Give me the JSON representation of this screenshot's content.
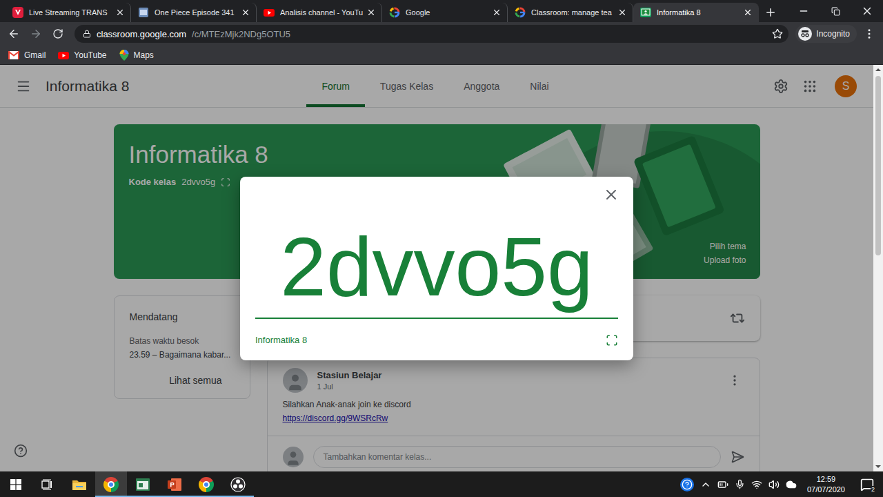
{
  "browser": {
    "tabs": [
      {
        "label": "Live Streaming TRANS",
        "kind": "vidio",
        "selected": false
      },
      {
        "label": "One Piece Episode 341",
        "kind": "page",
        "selected": false
      },
      {
        "label": "Analisis channel - YouTu",
        "kind": "youtube",
        "selected": false
      },
      {
        "label": "Google",
        "kind": "google",
        "selected": false
      },
      {
        "label": "Classroom: manage tea",
        "kind": "google",
        "selected": false
      },
      {
        "label": "Informatika 8",
        "kind": "classroom",
        "selected": true
      }
    ],
    "address": {
      "host": "classroom.google.com",
      "path": "/c/MTEzMjk2NDg5OTU5"
    },
    "bookmarked": false,
    "profile": "Incognito",
    "bookmarks": [
      {
        "label": "Gmail",
        "kind": "gmail"
      },
      {
        "label": "YouTube",
        "kind": "youtube"
      },
      {
        "label": "Maps",
        "kind": "maps"
      }
    ]
  },
  "classroom": {
    "title": "Informatika 8",
    "nav": [
      {
        "label": "Forum",
        "selected": true
      },
      {
        "label": "Tugas Kelas",
        "selected": false
      },
      {
        "label": "Anggota",
        "selected": false
      },
      {
        "label": "Nilai",
        "selected": false
      }
    ],
    "avatar": "S",
    "banner": {
      "title": "Informatika 8",
      "code_label": "Kode kelas",
      "code": "2dvvo5g",
      "actions": [
        "Pilih tema",
        "Upload foto"
      ]
    },
    "upcoming": {
      "title": "Mendatang",
      "due": "Batas waktu besok",
      "item": "23.59 – Bagaimana kabar...",
      "link": "Lihat semua"
    },
    "posts": [
      {
        "author": "Stasiun Belajar",
        "date": "1 Jul",
        "text": "Silahkan Anak-anak join ke discord",
        "link": "https://discord.gg/9WSRcRw",
        "comment_placeholder": "Tambahkan komentar kelas..."
      }
    ]
  },
  "dialog": {
    "code": "2dvvo5g",
    "class_name": "Informatika 8"
  },
  "taskbar": {
    "apps": [
      {
        "kind": "task-view",
        "running": false,
        "selected": false
      },
      {
        "kind": "explorer",
        "running": false,
        "selected": false
      },
      {
        "kind": "chrome",
        "running": true,
        "selected": true
      },
      {
        "kind": "window",
        "running": true,
        "selected": false
      },
      {
        "kind": "powerpoint",
        "running": true,
        "selected": false
      },
      {
        "kind": "chrome",
        "running": true,
        "selected": false
      },
      {
        "kind": "obs",
        "running": true,
        "selected": false
      }
    ],
    "time": "12:59",
    "date": "07/07/2020",
    "notifications": "2"
  }
}
